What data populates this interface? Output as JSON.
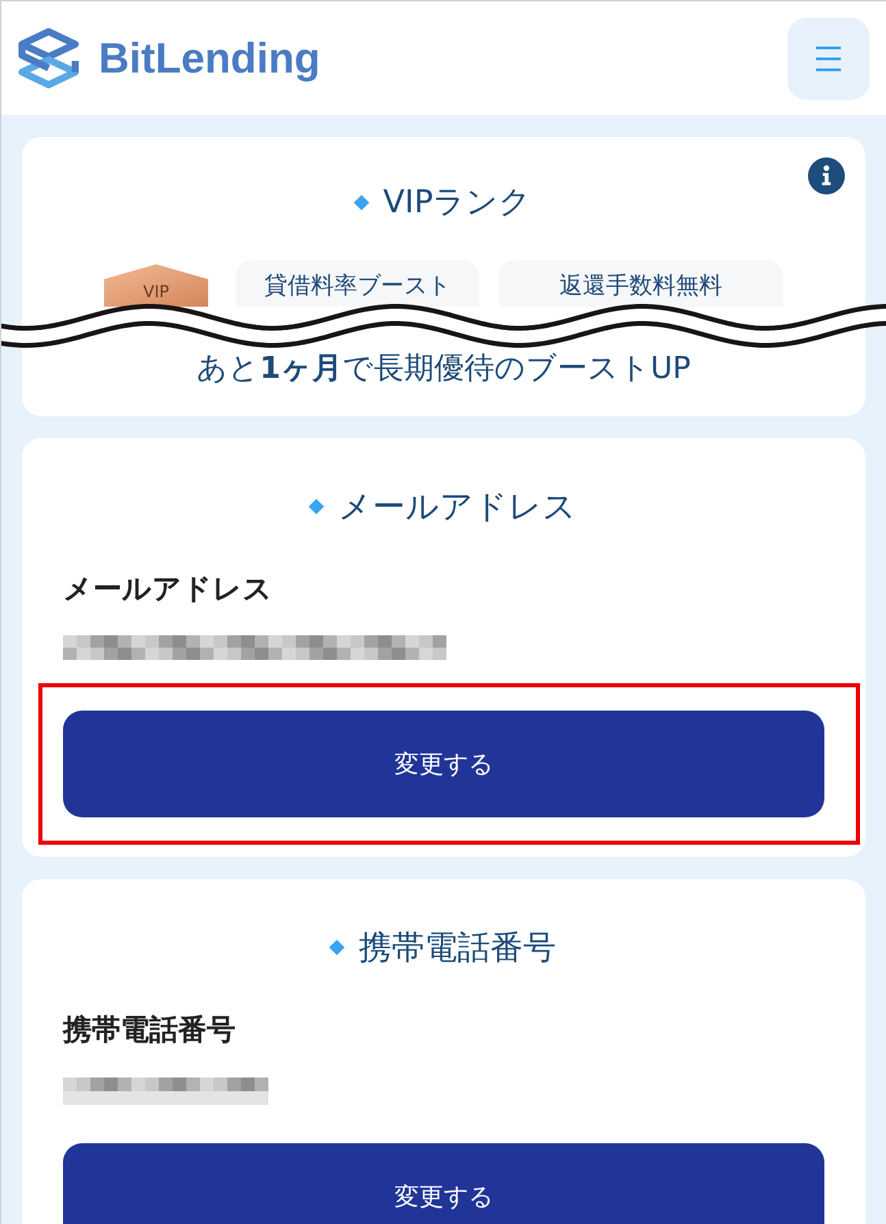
{
  "header": {
    "logo": "BitLending"
  },
  "vip_rank": {
    "title": "VIPランク",
    "badge": "VIP",
    "benefits": [
      "貸借料率ブースト",
      "返還手数料無料"
    ],
    "message": "あと**1ヶ月**で長期優待のブーストUP",
    "break_mark": true
  },
  "sections": [
    {
      "kind": "email",
      "title": "メールアドレス",
      "label": "メールアドレス",
      "button": "変更する",
      "highlighted": true
    },
    {
      "kind": "phone",
      "title": "携帯電話番号",
      "label": "携帯電話番号",
      "button": "変更する",
      "highlighted": false
    }
  ]
}
